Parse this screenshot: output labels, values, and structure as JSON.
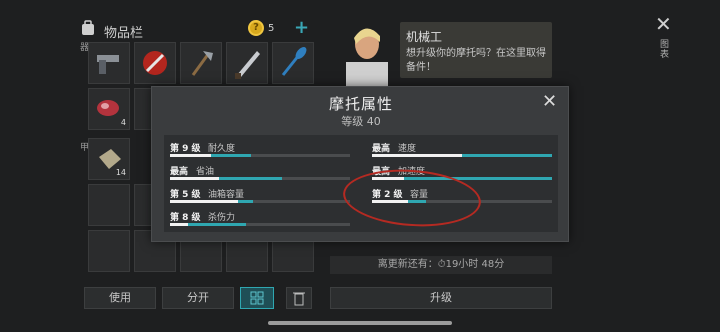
{
  "inventory": {
    "title": "物品栏",
    "coins": "5",
    "slot_labels": [
      "器",
      "甲"
    ],
    "items": [
      {
        "name": "pistol-icon",
        "count": ""
      },
      {
        "name": "no-entry-icon",
        "count": ""
      },
      {
        "name": "axe-icon",
        "count": ""
      },
      {
        "name": "machete-icon",
        "count": ""
      },
      {
        "name": "oar-icon",
        "count": ""
      },
      {
        "name": "raw-meat-icon",
        "count": "4"
      },
      {
        "name": "cloth-icon",
        "count": "14"
      }
    ],
    "buttons": {
      "use": "使用",
      "split": "分开"
    }
  },
  "mechanic": {
    "name": "机械工",
    "text": "想升级你的摩托吗？在这里取得备件！",
    "timer": "离更新还有：⏱19小时 48分",
    "upgrade": "升级"
  },
  "side_label": "图表",
  "modal": {
    "title": "摩托属性",
    "subtitle": "等级 40",
    "stats": [
      {
        "level": "第 9 级",
        "name": "耐久度",
        "white": 0.23,
        "teal": 0.22
      },
      {
        "level": "最高",
        "name": "速度",
        "white": 0.5,
        "teal": 0.5
      },
      {
        "level": "最高",
        "name": "省油",
        "white": 0.27,
        "teal": 0.35
      },
      {
        "level": "最高",
        "name": "加速度",
        "white": 0.18,
        "teal": 0.82
      },
      {
        "level": "第 5 级",
        "name": "油箱容量",
        "white": 0.38,
        "teal": 0.08
      },
      {
        "level": "第 2 级",
        "name": "容量",
        "white": 0.2,
        "teal": 0.1
      },
      {
        "level": "第 8 级",
        "name": "杀伤力",
        "white": 0.1,
        "teal": 0.32
      }
    ]
  },
  "colors": {
    "accent": "#2fa7b1",
    "annotation": "#b52a22"
  }
}
